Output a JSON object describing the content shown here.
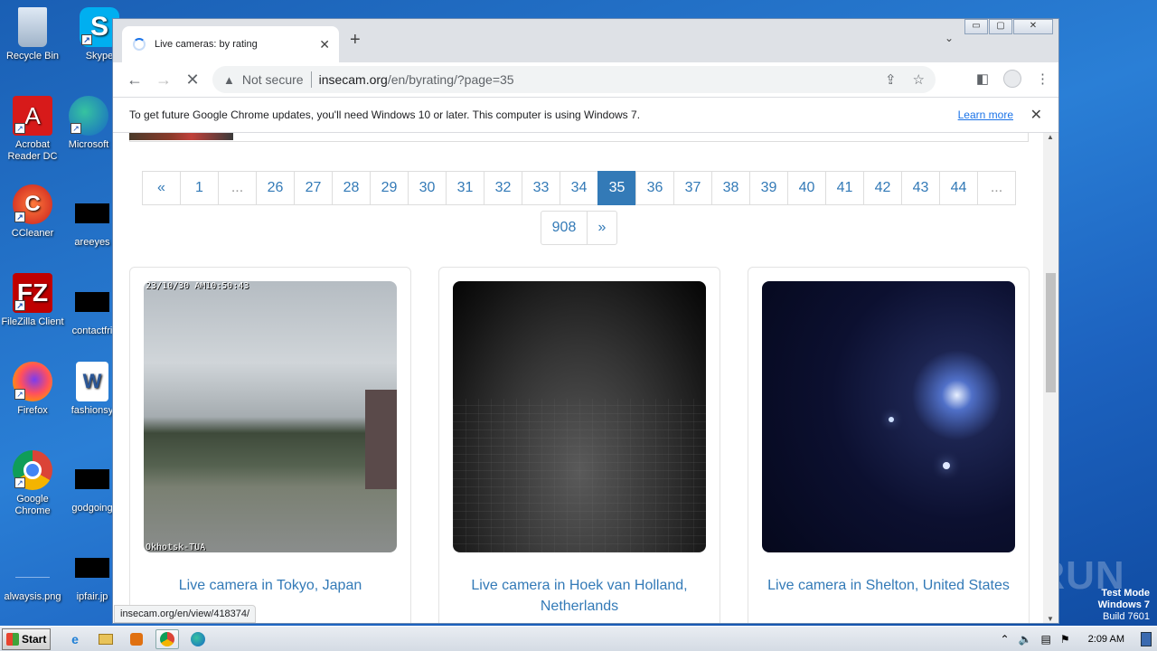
{
  "desktop": {
    "icons": [
      {
        "label": "Recycle Bin"
      },
      {
        "label": "Skype"
      },
      {
        "label": "Acrobat Reader DC"
      },
      {
        "label": "Microsoft"
      },
      {
        "label": "CCleaner"
      },
      {
        "label": "areeyes"
      },
      {
        "label": "FileZilla Client"
      },
      {
        "label": "contactfri"
      },
      {
        "label": "Firefox"
      },
      {
        "label": "fashionsy"
      },
      {
        "label": "Google Chrome"
      },
      {
        "label": "godgoing"
      },
      {
        "label": "alwaysis.png"
      },
      {
        "label": "ipfair.jp"
      }
    ],
    "watermark": {
      "line1": "Test Mode",
      "line2": "Windows 7",
      "line3": "Build 7601"
    },
    "anyrun": "ANY RUN"
  },
  "browser": {
    "tab": {
      "title": "Live cameras: by rating",
      "close": "✕"
    },
    "newtab": "+",
    "tabsearch": "⌄",
    "window_controls": {
      "minimize": "▭",
      "maximize": "▢",
      "close": "✕"
    },
    "nav": {
      "back": "←",
      "forward": "→",
      "reload": "✕"
    },
    "omnibox": {
      "security": "Not secure",
      "host": "insecam.org",
      "path": "/en/byrating/?page=35"
    },
    "infobar": {
      "message": "To get future Google Chrome updates, you'll need Windows 10 or later. This computer is using Windows 7.",
      "link": "Learn more",
      "close": "✕"
    },
    "status_url": "insecam.org/en/view/418374/"
  },
  "pagination": {
    "row1": [
      "«",
      "1",
      "...",
      "26",
      "27",
      "28",
      "29",
      "30",
      "31",
      "32",
      "33",
      "34",
      "35",
      "36",
      "37",
      "38",
      "39",
      "40",
      "41",
      "42",
      "43",
      "44",
      "..."
    ],
    "active": "35",
    "row2": [
      "908",
      "»"
    ]
  },
  "cameras": [
    {
      "caption": "Live camera in Tokyo, Japan",
      "overlay_top": "23/10/30 AM10:50:43",
      "overlay_bottom": "Okhotsk-TUA"
    },
    {
      "caption": "Live camera in Hoek van Holland, Netherlands"
    },
    {
      "caption": "Live camera in Shelton, United States"
    }
  ],
  "taskbar": {
    "start": "Start",
    "clock": "2:09 AM"
  }
}
